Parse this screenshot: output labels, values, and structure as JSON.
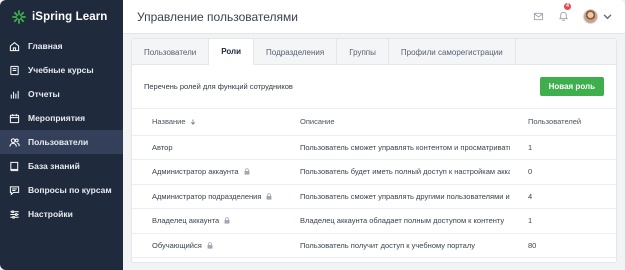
{
  "brand": {
    "name": "iSpring Learn",
    "accent": "#3fae4d"
  },
  "sidebar": {
    "items": [
      {
        "label": "Главная",
        "icon": "home-icon"
      },
      {
        "label": "Учебные курсы",
        "icon": "book-icon"
      },
      {
        "label": "Отчеты",
        "icon": "bar-chart-icon"
      },
      {
        "label": "Мероприятия",
        "icon": "calendar-icon"
      },
      {
        "label": "Пользователи",
        "icon": "users-icon",
        "active": true
      },
      {
        "label": "База знаний",
        "icon": "book-open-icon"
      },
      {
        "label": "Вопросы по курсам",
        "icon": "chat-icon"
      },
      {
        "label": "Настройки",
        "icon": "sliders-icon"
      }
    ]
  },
  "header": {
    "title": "Управление пользователями",
    "notification_count": "4"
  },
  "tabs": [
    {
      "label": "Пользователи"
    },
    {
      "label": "Роли",
      "active": true
    },
    {
      "label": "Подразделения"
    },
    {
      "label": "Группы"
    },
    {
      "label": "Профили саморегистрации"
    }
  ],
  "toolbar": {
    "description": "Перечень ролей для функций сотрудников",
    "new_role_label": "Новая роль"
  },
  "table": {
    "headers": {
      "name": "Название",
      "description": "Описание",
      "users": "Пользователей"
    },
    "rows": [
      {
        "name": "Автор",
        "locked": false,
        "description": "Пользователь сможет управлять контентом и просматривать",
        "users": "1"
      },
      {
        "name": "Администратор аккаунта",
        "locked": true,
        "description": "Пользователь будет иметь полный доступ к настройкам аккаунта",
        "users": "0"
      },
      {
        "name": "Администратор подразделения",
        "locked": true,
        "description": "Пользователь сможет управлять другими пользователями из подразделения",
        "users": "4"
      },
      {
        "name": "Владелец аккаунта",
        "locked": true,
        "description": "Владелец аккаунта обладает полным доступом к контенту",
        "users": "1"
      },
      {
        "name": "Обучающийся",
        "locked": true,
        "description": "Пользователь получит доступ к учебному порталу",
        "users": "80"
      }
    ]
  }
}
